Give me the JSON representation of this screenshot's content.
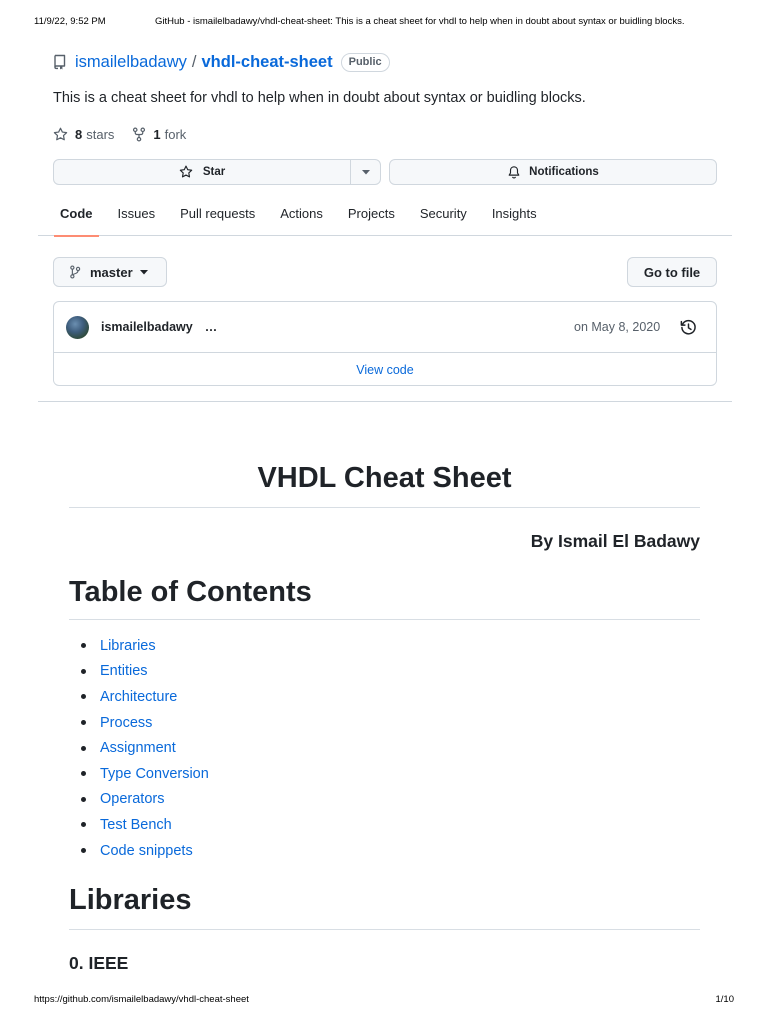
{
  "print_header": {
    "datetime": "11/9/22, 9:52 PM",
    "page_title": "GitHub - ismailelbadawy/vhdl-cheat-sheet: This is a cheat sheet for vhdl to help when in doubt about syntax or buidling blocks."
  },
  "repo": {
    "owner": "ismailelbadawy",
    "separator": "/",
    "name": "vhdl-cheat-sheet",
    "visibility": "Public",
    "description": "This is a cheat sheet for vhdl to help when in doubt about syntax or buidling blocks.",
    "stars_count": "8",
    "stars_label": "stars",
    "forks_count": "1",
    "forks_label": "fork"
  },
  "actions": {
    "star_label": "Star",
    "notifications_label": "Notifications"
  },
  "tabs": [
    {
      "label": "Code",
      "active": true
    },
    {
      "label": "Issues"
    },
    {
      "label": "Pull requests"
    },
    {
      "label": "Actions"
    },
    {
      "label": "Projects"
    },
    {
      "label": "Security"
    },
    {
      "label": "Insights"
    }
  ],
  "branch": {
    "name": "master",
    "go_to_file_label": "Go to file"
  },
  "commit": {
    "author": "ismailelbadawy",
    "ellipsis": "…",
    "date": "on May 8, 2020",
    "view_code_label": "View code"
  },
  "readme": {
    "title": "VHDL Cheat Sheet",
    "byline": "By Ismail El Badawy",
    "toc_heading": "Table of Contents",
    "toc_items": [
      "Libraries",
      "Entities",
      "Architecture",
      "Process",
      "Assignment",
      "Type Conversion",
      "Operators",
      "Test Bench",
      "Code snippets"
    ],
    "libraries_heading": "Libraries",
    "ieee_heading": "0. IEEE"
  },
  "print_footer": {
    "url": "https://github.com/ismailelbadawy/vhdl-cheat-sheet",
    "page": "1/10"
  },
  "colors": {
    "link": "#0969da",
    "text": "#1f2328",
    "muted": "#57606a",
    "border": "#d0d7de",
    "tab_underline": "#fd8c73"
  }
}
